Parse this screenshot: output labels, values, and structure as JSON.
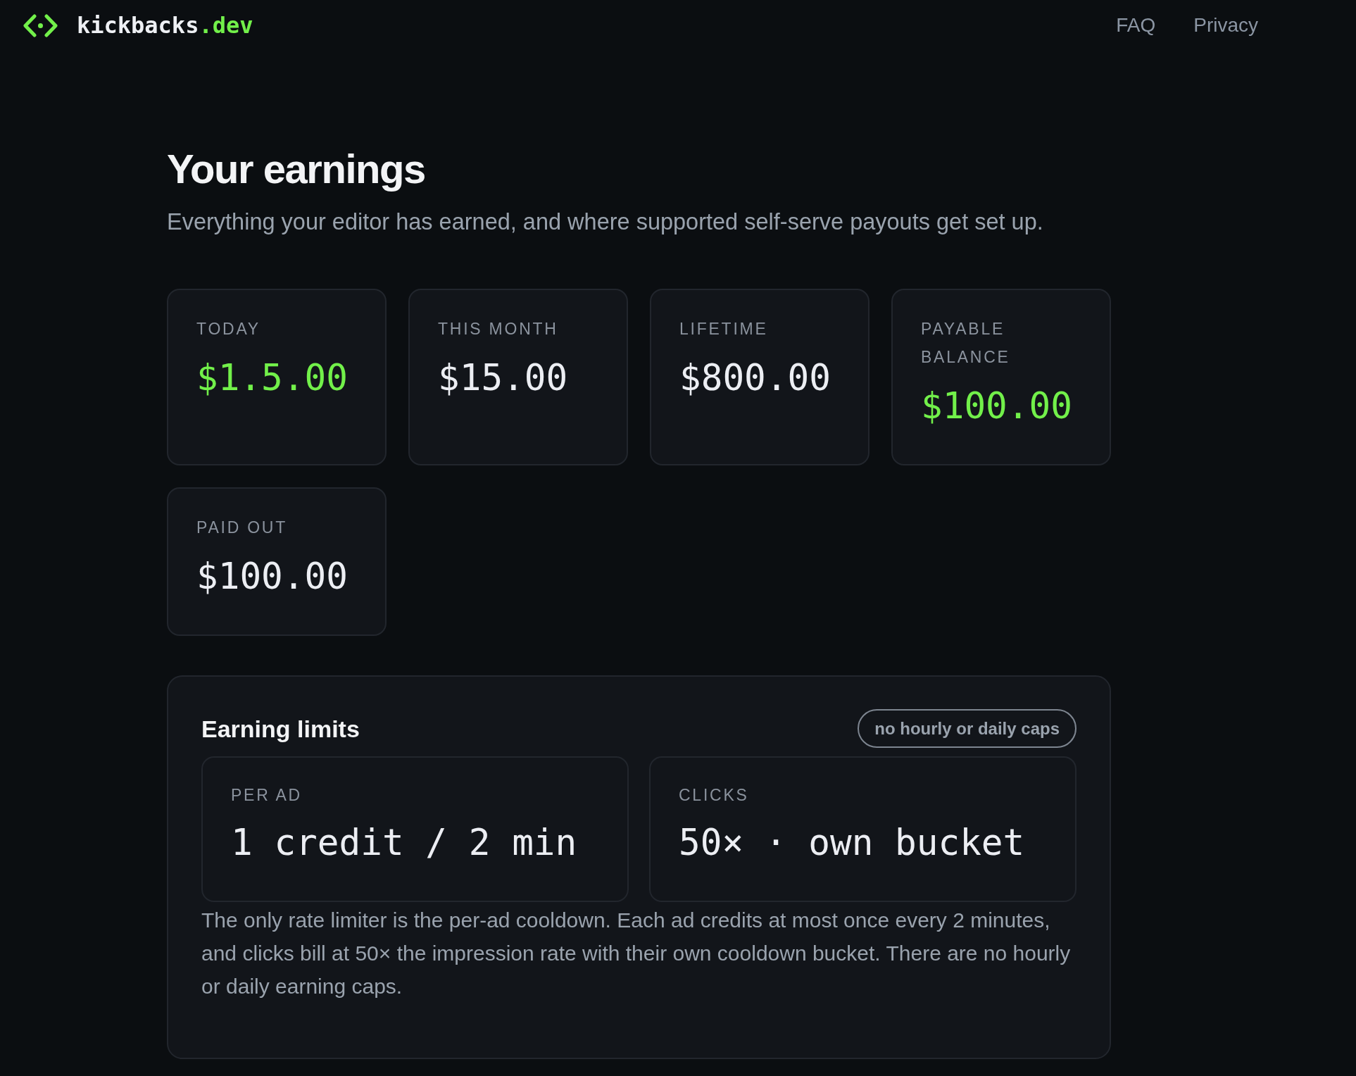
{
  "header": {
    "brand": {
      "name": "kickbacks",
      "suffix": ".dev"
    },
    "nav": [
      {
        "label": "FAQ"
      },
      {
        "label": "Privacy"
      }
    ]
  },
  "page": {
    "title": "Your earnings",
    "subtitle": "Everything your editor has earned, and where supported self-serve payouts get set up."
  },
  "stats": [
    {
      "label": "TODAY",
      "value": "$1.5.00",
      "accent": true
    },
    {
      "label": "THIS MONTH",
      "value": "$15.00",
      "accent": false
    },
    {
      "label": "LIFETIME",
      "value": "$800.00",
      "accent": false
    },
    {
      "label": "PAYABLE BALANCE",
      "value": "$100.00",
      "accent": true
    },
    {
      "label": "PAID OUT",
      "value": "$100.00",
      "accent": false
    }
  ],
  "limits": {
    "title": "Earning limits",
    "badge": "no hourly or daily caps",
    "items": [
      {
        "label": "PER AD",
        "value": "1 credit / 2 min"
      },
      {
        "label": "CLICKS",
        "value": "50× · own bucket"
      }
    ],
    "note": "The only rate limiter is the per-ad cooldown. Each ad credits at most once every 2 minutes, and clicks bill at 50× the impression rate with their own cooldown bucket. There are no hourly or daily earning caps."
  }
}
